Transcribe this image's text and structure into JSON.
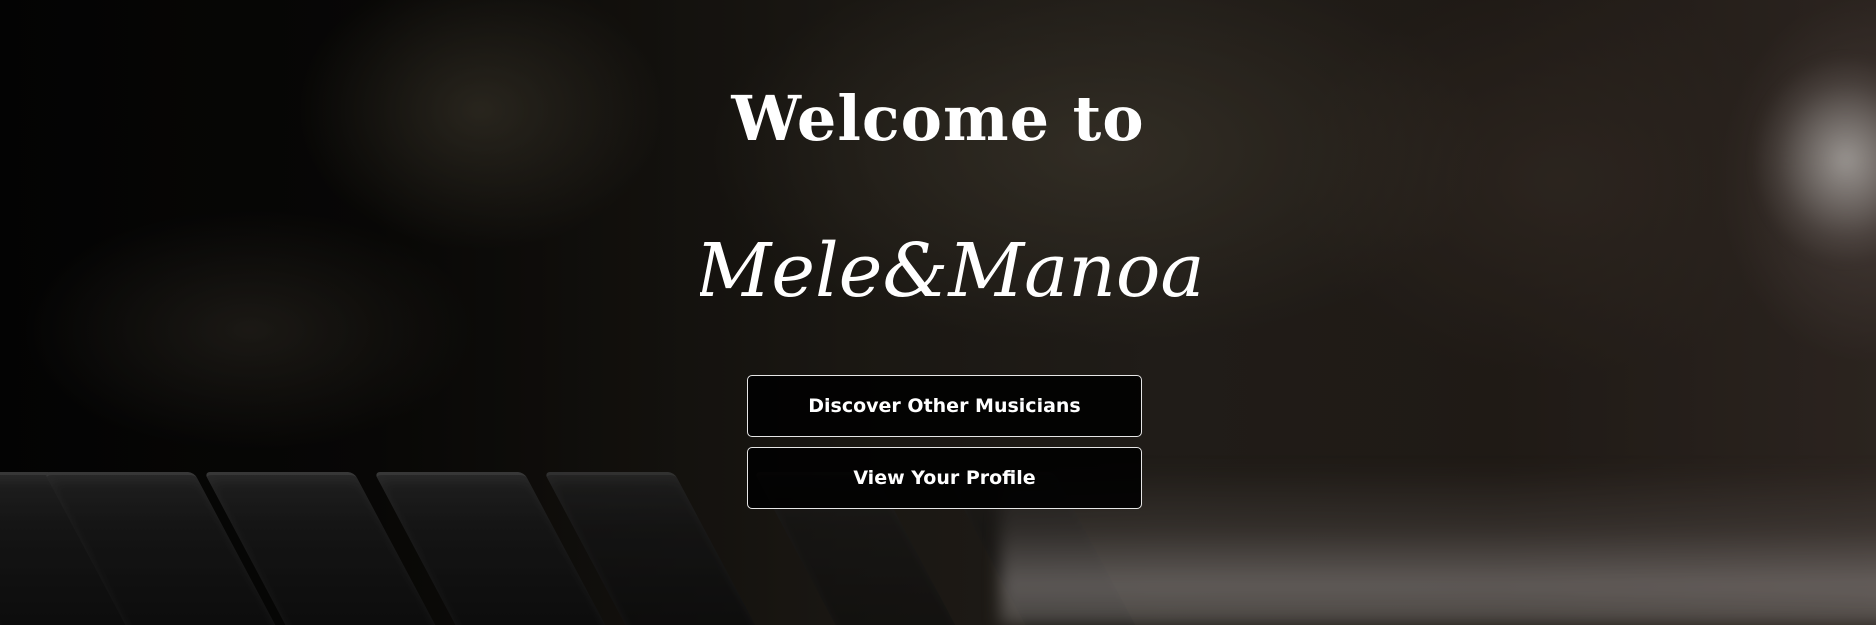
{
  "hero": {
    "heading": "Welcome to",
    "logo_text": "Mele&Manoa"
  },
  "buttons": {
    "discover_label": "Discover Other Musicians",
    "profile_label": "View Your Profile"
  },
  "colors": {
    "text": "#ffffff",
    "button_background": "#0a0a0a",
    "button_border": "#e6e6e6"
  }
}
